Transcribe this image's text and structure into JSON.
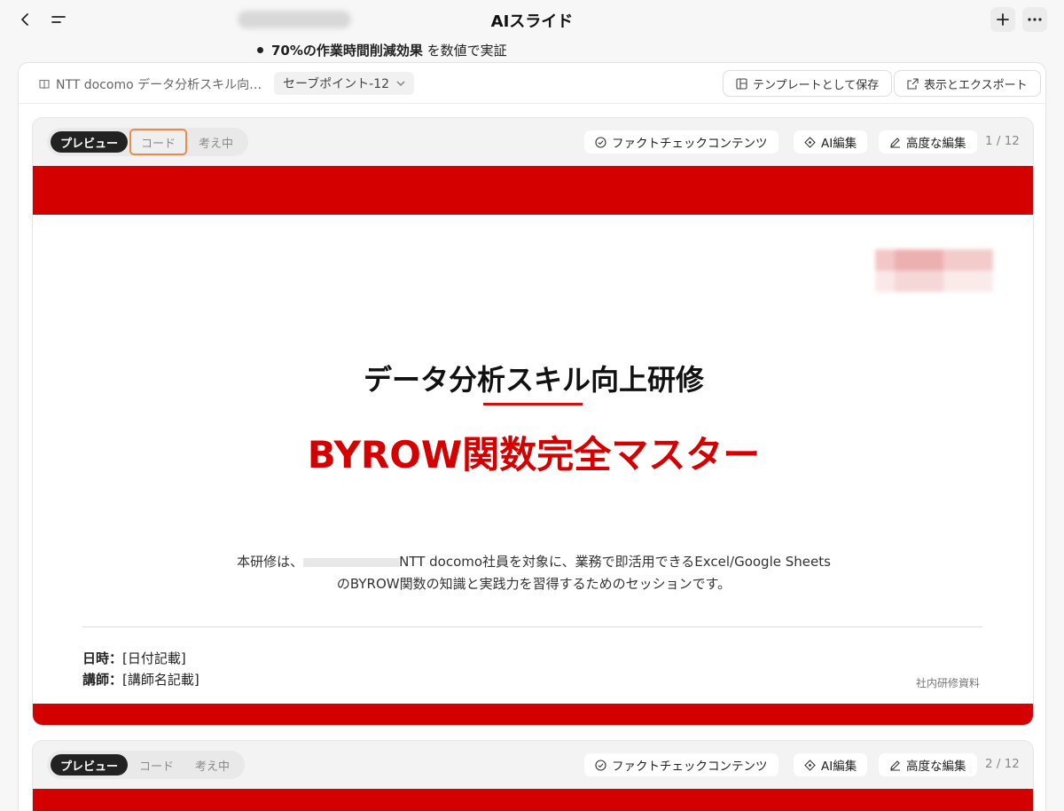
{
  "app": {
    "title": "AIスライド"
  },
  "chat_context": {
    "bullet_bold": "70%の作業時間削減効果",
    "bullet_rest": " を数値で実証"
  },
  "panel": {
    "doc_name": "NTT docomo データ分析スキル向…",
    "savepoint": "セーブポイント-12",
    "save_template_label": "テンプレートとして保存",
    "export_label": "表示とエクスポート"
  },
  "toolbar": {
    "tabs": [
      "プレビュー",
      "コード",
      "考え中"
    ],
    "fact_check_label": "ファクトチェックコンテンツ",
    "ai_edit_label": "AI編集",
    "advanced_edit_label": "高度な編集"
  },
  "slides": [
    {
      "page": "1 / 12",
      "title": "データ分析スキル向上研修",
      "subtitle": "BYROW関数完全マスター",
      "desc_line1_a": "本研修は、",
      "desc_line1_b": "NTT docomo社員を対象に、業務で即活用できるExcel/Google Sheets",
      "desc_line2": "のBYROW関数の知識と実践力を習得するためのセッションです。",
      "date_label": "日時：",
      "date_value": "[日付記載]",
      "lecturer_label": "講師：",
      "lecturer_value": "[講師名記載]",
      "footnote": "社内研修資料"
    },
    {
      "page": "2 / 12"
    }
  ],
  "colors": {
    "brand_red": "#d40000",
    "focus_orange": "#f0884a"
  }
}
